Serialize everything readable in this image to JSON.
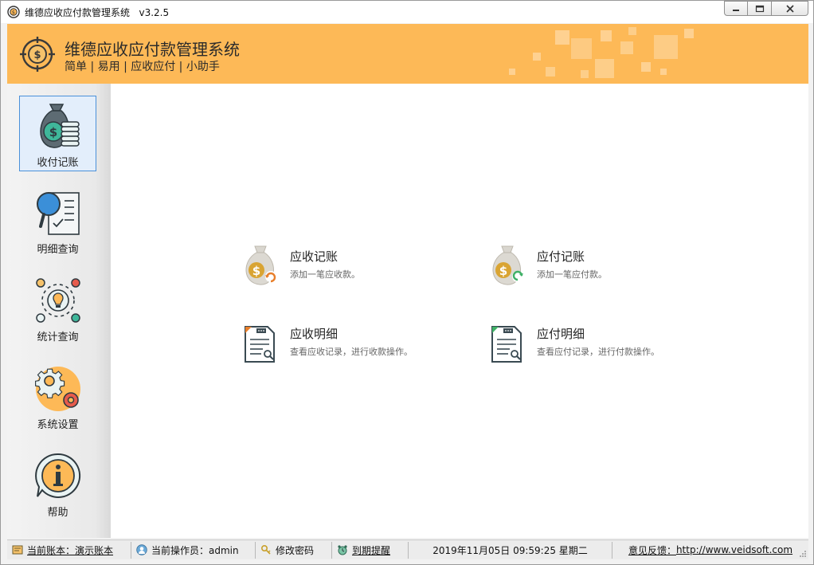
{
  "window": {
    "title": "维德应收应付款管理系统",
    "version": "v3.2.5",
    "controls": {
      "minimize": "▭",
      "maximize": "▢",
      "close": "✕"
    }
  },
  "banner": {
    "title": "维德应收应付款管理系统",
    "subtitle": "简单 | 易用 | 应收应付 | 小助手",
    "color": "#fdb957"
  },
  "sidebar": {
    "items": [
      {
        "label": "收付记账",
        "icon": "money-bag-icon",
        "active": true
      },
      {
        "label": "明细查询",
        "icon": "magnifier-document-icon",
        "active": false
      },
      {
        "label": "统计查询",
        "icon": "lightbulb-cycle-icon",
        "active": false
      },
      {
        "label": "系统设置",
        "icon": "gears-icon",
        "active": false
      },
      {
        "label": "帮助",
        "icon": "info-bubble-icon",
        "active": false
      }
    ]
  },
  "main": {
    "tiles": [
      {
        "title": "应收记账",
        "desc": "添加一笔应收款。",
        "icon": "receivable-bag-icon"
      },
      {
        "title": "应付记账",
        "desc": "添加一笔应付款。",
        "icon": "payable-bag-icon"
      },
      {
        "title": "应收明细",
        "desc": "查看应收记录，进行收款操作。",
        "icon": "receivable-report-icon"
      },
      {
        "title": "应付明细",
        "desc": "查看应付记录，进行付款操作。",
        "icon": "payable-report-icon"
      }
    ]
  },
  "statusbar": {
    "account": "当前账本：演示账本",
    "operator": "当前操作员：admin",
    "change_password": "修改密码",
    "due_reminder": "到期提醒",
    "datetime": "2019年11月05日 09:59:25 星期二",
    "feedback_label": "意见反馈：",
    "feedback_url": "http://www.veidsoft.com"
  }
}
